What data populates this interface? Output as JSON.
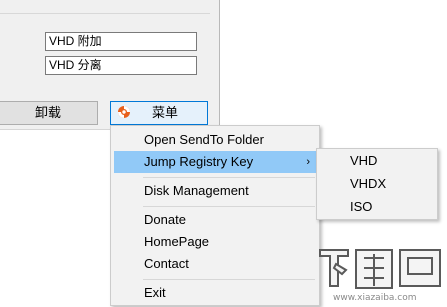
{
  "fields": {
    "attach_value": "VHD 附加",
    "detach_value": "VHD 分离"
  },
  "buttons": {
    "unmount_label": "卸载",
    "menu_label": "菜单"
  },
  "context_menu": {
    "items": [
      "Open SendTo Folder",
      "Jump Registry Key",
      "Disk Management",
      "Donate",
      "HomePage",
      "Contact",
      "Exit"
    ],
    "submenu_arrow": "›",
    "highlight_color": "#91c9f7"
  },
  "submenu": {
    "items": [
      "VHD",
      "VHDX",
      "ISO"
    ]
  },
  "watermark": {
    "logo_text": "下载吧",
    "url_text": "www.xiazaiba.com"
  }
}
